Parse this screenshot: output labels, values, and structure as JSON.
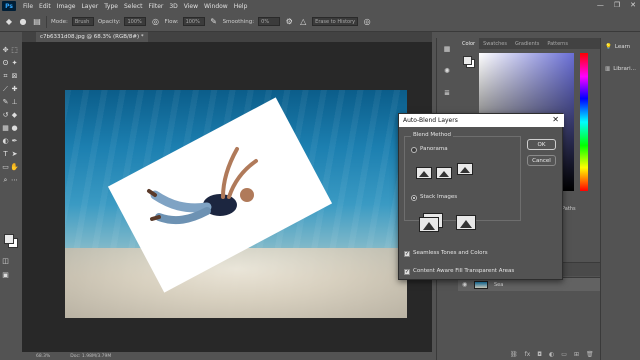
{
  "app": {
    "logo": "Ps"
  },
  "menu": [
    "File",
    "Edit",
    "Image",
    "Layer",
    "Type",
    "Select",
    "Filter",
    "3D",
    "View",
    "Window",
    "Help"
  ],
  "window_controls": [
    "—",
    "❐",
    "✕"
  ],
  "options_bar": {
    "mode_label": "Mode:",
    "mode_value": "Brush",
    "opacity_label": "Opacity:",
    "opacity_value": "100%",
    "flow_label": "Flow:",
    "flow_value": "100%",
    "smoothing_label": "Smoothing:",
    "smoothing_value": "0%",
    "erase_history_label": "Erase to History"
  },
  "document_tab": {
    "label": "c7b6331d08.jpg @ 68.3% (RGB/8#) *"
  },
  "status_bar": {
    "zoom": "68.3%",
    "doc_info": "Doc: 1.98M/3.79M"
  },
  "color_panel": {
    "tabs": [
      "Color",
      "Swatches",
      "Gradients",
      "Patterns"
    ],
    "active_tab": "Color"
  },
  "libraries": {
    "items": [
      "Learn",
      "Librari..."
    ]
  },
  "layers": {
    "partial_tab": "Paths",
    "rows": [
      {
        "name": "Sea"
      }
    ]
  },
  "dialog": {
    "title": "Auto-Blend Layers",
    "close": "✕",
    "group_label": "Blend Method",
    "options": [
      {
        "label": "Panorama",
        "selected": false
      },
      {
        "label": "Stack Images",
        "selected": true
      }
    ],
    "checkboxes": [
      {
        "label": "Seamless Tones and Colors",
        "checked": true
      },
      {
        "label": "Content Aware Fill Transparent Areas",
        "checked": true
      }
    ],
    "ok_label": "OK",
    "cancel_label": "Cancel",
    "check_mark": "✓"
  },
  "colors": {
    "ui_gray": "#535353",
    "canvas_bg": "#282828",
    "dialog_title_bg": "#ffffff",
    "water_top": "#0b5d8a",
    "sand": "#ddd7c7"
  },
  "icons": {
    "toolbar": [
      "move-icon",
      "marquee-icon",
      "lasso-icon",
      "quick-select-icon",
      "crop-icon",
      "frame-icon",
      "eyedropper-icon",
      "spot-heal-icon",
      "brush-icon",
      "stamp-icon",
      "history-brush-icon",
      "eraser-icon",
      "gradient-icon",
      "blur-icon",
      "dodge-icon",
      "pen-icon",
      "type-icon",
      "path-select-icon",
      "shape-icon",
      "hand-icon",
      "zoom-icon",
      "more-tools-icon"
    ],
    "options": [
      "eraser-icon",
      "brush-preset-icon",
      "brush-settings-icon",
      "pressure-opacity-icon",
      "airbrush-icon",
      "settings-gear-icon",
      "angle-icon",
      "pressure-size-icon"
    ]
  }
}
